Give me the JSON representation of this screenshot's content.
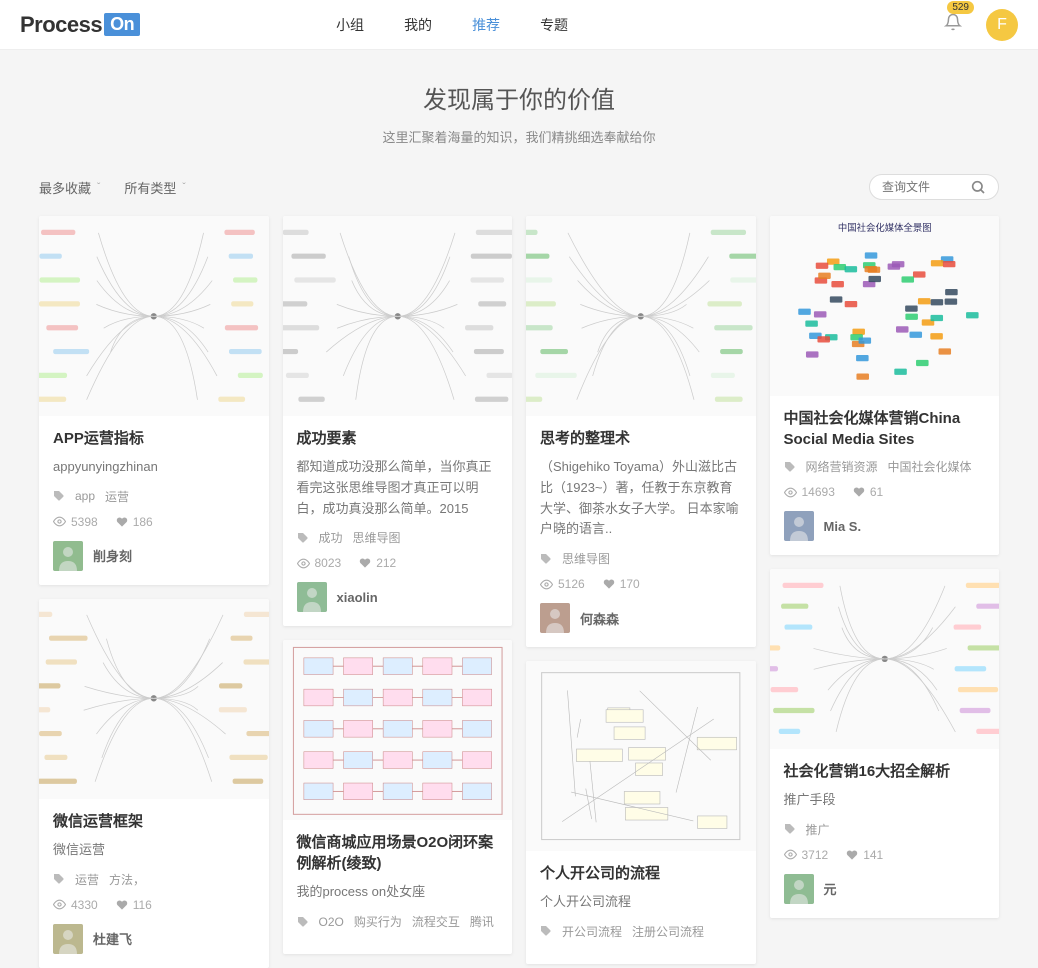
{
  "header": {
    "logo_main": "Process",
    "logo_accent": "On",
    "nav": [
      "小组",
      "我的",
      "推荐",
      "专题"
    ],
    "nav_active": 2,
    "badge": "529",
    "avatar_letter": "F"
  },
  "hero": {
    "title": "发现属于你的价值",
    "subtitle": "这里汇聚着海量的知识，我们精挑细选奉献给你"
  },
  "filters": {
    "sort": "最多收藏",
    "type": "所有类型"
  },
  "search": {
    "placeholder": "查询文件"
  },
  "cards": [
    {
      "title": "APP运营指标",
      "desc": "appyunyingzhinan",
      "tags": [
        "app",
        "运营"
      ],
      "views": "5398",
      "likes": "186",
      "author": "削身刻",
      "thumb_style": "mindmap-pastel",
      "thumb_h": 200
    },
    {
      "title": "微信运营框架",
      "desc": "微信运营",
      "tags": [
        "运营",
        "方法，"
      ],
      "views": "4330",
      "likes": "116",
      "author": "杜建飞",
      "thumb_style": "mindmap-tan",
      "thumb_h": 200
    },
    {
      "title": "成功要素",
      "desc": "都知道成功没那么简单，当你真正看完这张思维导图才真正可以明白，成功真没那么简单。2015",
      "tags": [
        "成功",
        "思维导图"
      ],
      "views": "8023",
      "likes": "212",
      "author": "xiaolin",
      "thumb_style": "mindmap-grey",
      "thumb_h": 200
    },
    {
      "title": "微信商城应用场景O2O闭环案例解析(绫致)",
      "desc": "我的process on处女座",
      "tags": [
        "O2O",
        "购买行为",
        "流程交互",
        "腾讯"
      ],
      "views": "",
      "likes": "",
      "author": "",
      "thumb_style": "flowchart",
      "thumb_h": 180
    },
    {
      "title": "思考的整理术",
      "desc": "（Shigehiko Toyama）外山滋比古比（1923~）著，任教于东京教育大学、御茶水女子大学。 日本家喻户晓的语言..",
      "tags": [
        "思维导图"
      ],
      "views": "5126",
      "likes": "170",
      "author": "何森森",
      "thumb_style": "mindmap-green",
      "thumb_h": 200
    },
    {
      "title": "个人开公司的流程",
      "desc": "个人开公司流程",
      "tags": [
        "开公司流程",
        "注册公司流程"
      ],
      "views": "",
      "likes": "",
      "author": "",
      "thumb_style": "wireframe",
      "thumb_h": 190
    },
    {
      "title": "中国社会化媒体营销China Social Media Sites",
      "desc": "",
      "tags": [
        "网络营销资源",
        "中国社会化媒体"
      ],
      "views": "14693",
      "likes": "61",
      "author": "Mia S.",
      "thumb_style": "logos",
      "thumb_h": 180
    },
    {
      "title": "社会化营销16大招全解析",
      "desc": "推广手段",
      "tags": [
        "推广"
      ],
      "views": "3712",
      "likes": "141",
      "author": "元",
      "thumb_style": "mindmap-rainbow",
      "thumb_h": 180
    }
  ]
}
